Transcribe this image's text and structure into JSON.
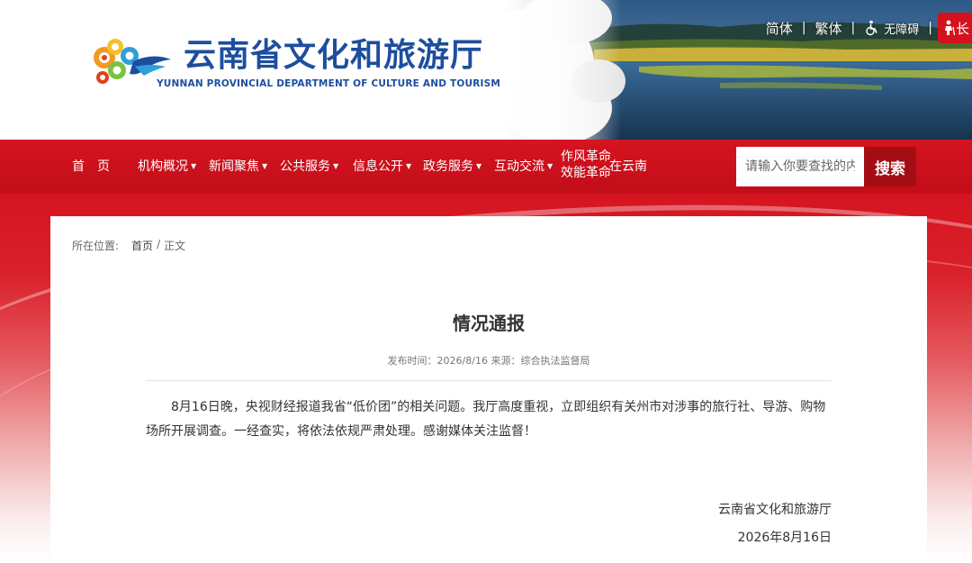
{
  "header": {
    "title": "云南省文化和旅游厅",
    "subtitle": "YUNNAN PROVINCIAL DEPARTMENT OF CULTURE AND TOURISM",
    "logo_icon": "auspicious-cloud-logo"
  },
  "top_links": {
    "simplified": "简体",
    "traditional": "繁体",
    "separator": "|",
    "accessibility": "无障碍",
    "accessibility_icon": "wheelchair-icon",
    "elder_mode": "长"
  },
  "nav": {
    "items": [
      {
        "label": "首　页",
        "dropdown": false
      },
      {
        "label": "机构概况",
        "dropdown": true
      },
      {
        "label": "新闻聚焦",
        "dropdown": true
      },
      {
        "label": "公共服务",
        "dropdown": true
      },
      {
        "label": "信息公开",
        "dropdown": true
      },
      {
        "label": "政务服务",
        "dropdown": true
      },
      {
        "label": "互动交流",
        "dropdown": true
      }
    ],
    "special_line1": "作风革命",
    "special_line2": "效能革命",
    "special_suffix": "在云南",
    "caret": "▼"
  },
  "search": {
    "placeholder": "请输入你要查找的内容",
    "button": "搜索"
  },
  "breadcrumb": {
    "label": "所在位置:",
    "home": "首页",
    "sep": "/",
    "current": "正文"
  },
  "article": {
    "title": "情况通报",
    "meta": "发布时间：2026/8/16 来源：综合执法监督局",
    "body": "8月16日晚，央视财经报道我省“低价团”的相关问题。我厅高度重视，立即组织有关州市对涉事的旅行社、导游、购物场所开展调查。一经查实，将依法依规严肃处理。感谢媒体关注监督！",
    "sign_org": "云南省文化和旅游厅",
    "sign_date": "2026年8月16日"
  },
  "colors": {
    "brand_red": "#d51420",
    "title_blue": "#1d4e9e",
    "search_button": "#a50d14"
  }
}
